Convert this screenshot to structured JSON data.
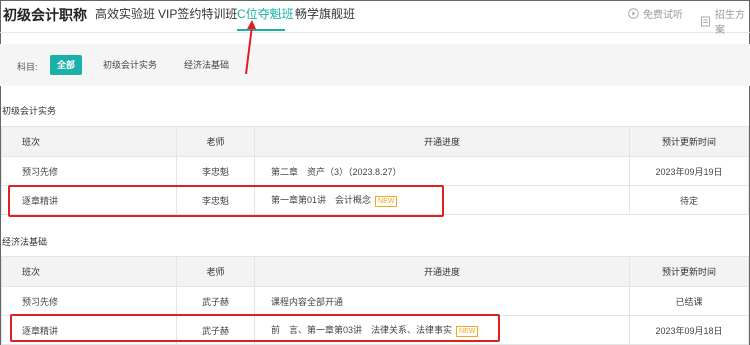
{
  "header": {
    "brand": "初级会计职称",
    "tabs": [
      {
        "label": "高效实验班",
        "active": false
      },
      {
        "label": "VIP签约特训班",
        "active": false
      },
      {
        "label": "C位夺魁班",
        "active": true
      },
      {
        "label": "畅学旗舰班",
        "active": false
      }
    ],
    "free_trial": "免费试听",
    "enroll_plan": "招生方案"
  },
  "filter": {
    "label": "科目:",
    "options": [
      {
        "label": "全部",
        "active": true
      },
      {
        "label": "初级会计实务",
        "active": false
      },
      {
        "label": "经济法基础",
        "active": false
      }
    ]
  },
  "sections": [
    {
      "title": "初级会计实务",
      "columns": [
        "班次",
        "老师",
        "开通进度",
        "预计更新时间"
      ],
      "rows": [
        {
          "class_name": "预习先修",
          "teacher": "李忠魁",
          "progress": "第二章　资产（3）（2023.8.27）",
          "badge": "",
          "update": "2023年09月19日"
        },
        {
          "class_name": "逐章精讲",
          "teacher": "李忠魁",
          "progress": "第一章第01讲　会计概念",
          "badge": "NEW",
          "update": "待定"
        }
      ]
    },
    {
      "title": "经济法基础",
      "columns": [
        "班次",
        "老师",
        "开通进度",
        "预计更新时间"
      ],
      "rows": [
        {
          "class_name": "预习先修",
          "teacher": "武子赫",
          "progress": "课程内容全部开通",
          "badge": "",
          "update": "已结课"
        },
        {
          "class_name": "逐章精讲",
          "teacher": "武子赫",
          "progress": "前　言、第一章第03讲　法律关系、法律事实",
          "badge": "NEW",
          "update": "2023年09月18日"
        }
      ]
    }
  ],
  "colors": {
    "accent": "#1bb1a8",
    "annotation": "#e02020",
    "badge": "#f5a623"
  }
}
